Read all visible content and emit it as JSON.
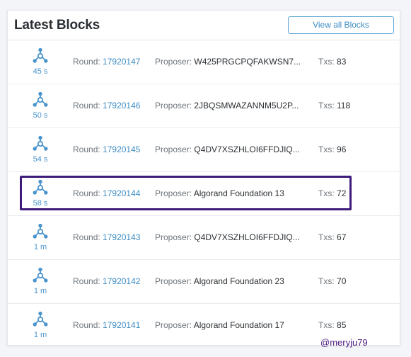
{
  "header": {
    "title": "Latest Blocks",
    "view_all_label": "View all Blocks"
  },
  "labels": {
    "round": "Round:",
    "proposer": "Proposer:",
    "txs": "Txs:"
  },
  "blocks": [
    {
      "age": "45 s",
      "round": "17920147",
      "proposer": "W425PRGCPQFAKWSN7...",
      "txs": "83"
    },
    {
      "age": "50 s",
      "round": "17920146",
      "proposer": "2JBQSMWAZANNM5U2P...",
      "txs": "118"
    },
    {
      "age": "54 s",
      "round": "17920145",
      "proposer": "Q4DV7XSZHLOI6FFDJIQ...",
      "txs": "96"
    },
    {
      "age": "58 s",
      "round": "17920144",
      "proposer": "Algorand Foundation 13",
      "txs": "72"
    },
    {
      "age": "1 m",
      "round": "17920143",
      "proposer": "Q4DV7XSZHLOI6FFDJIQ...",
      "txs": "67"
    },
    {
      "age": "1 m",
      "round": "17920142",
      "proposer": "Algorand Foundation 23",
      "txs": "70"
    },
    {
      "age": "1 m",
      "round": "17920141",
      "proposer": "Algorand Foundation 17",
      "txs": "85"
    }
  ],
  "icon": "block-node-icon",
  "highlighted_round": "17920144",
  "watermark": "@meryju79",
  "colors": {
    "accent": "#3d8dc4",
    "icon": "#4a94cc",
    "highlight": "#3e1a7a",
    "watermark": "#4b1b82"
  }
}
